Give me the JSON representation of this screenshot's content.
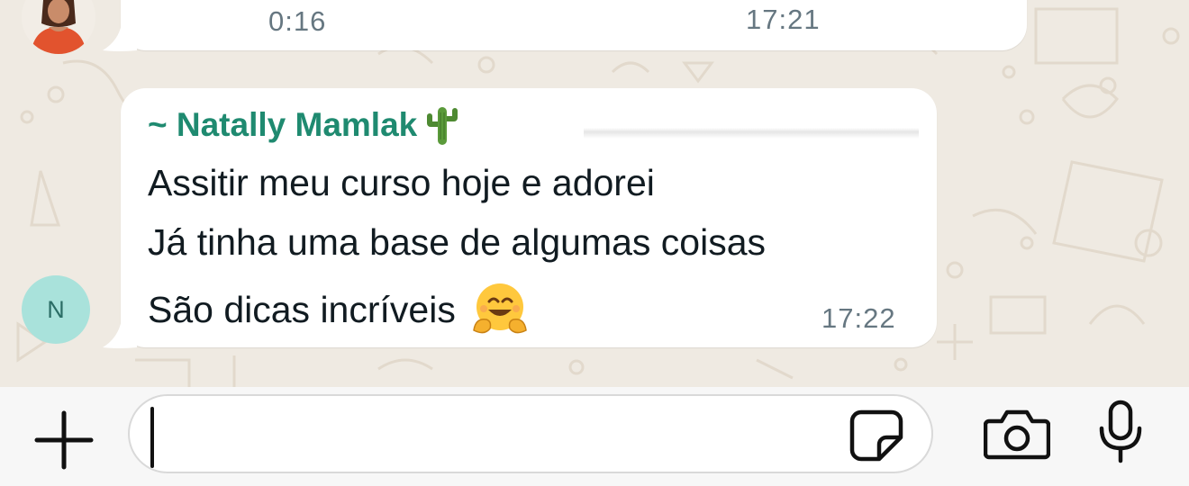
{
  "previous_message": {
    "audio_duration": "0:16",
    "time": "17:21"
  },
  "message": {
    "sender": "~ Natally Mamlak",
    "sender_emoji": "cactus",
    "lines": [
      "Assitir meu curso hoje e adorei",
      "Já tinha uma base de algumas coisas",
      "São dicas incríveis"
    ],
    "line_emoji": "hugging-face",
    "time": "17:22"
  },
  "sender_avatar": {
    "initial": "N",
    "color": "#a9e2db"
  },
  "composer": {
    "input_value": "",
    "icons": [
      "plus-icon",
      "sticker-icon",
      "camera-icon",
      "microphone-icon"
    ]
  },
  "colors": {
    "background": "#efeae2",
    "bubble": "#ffffff",
    "sender_name": "#1f8a70",
    "timestamp": "#667781",
    "text": "#111b21"
  }
}
